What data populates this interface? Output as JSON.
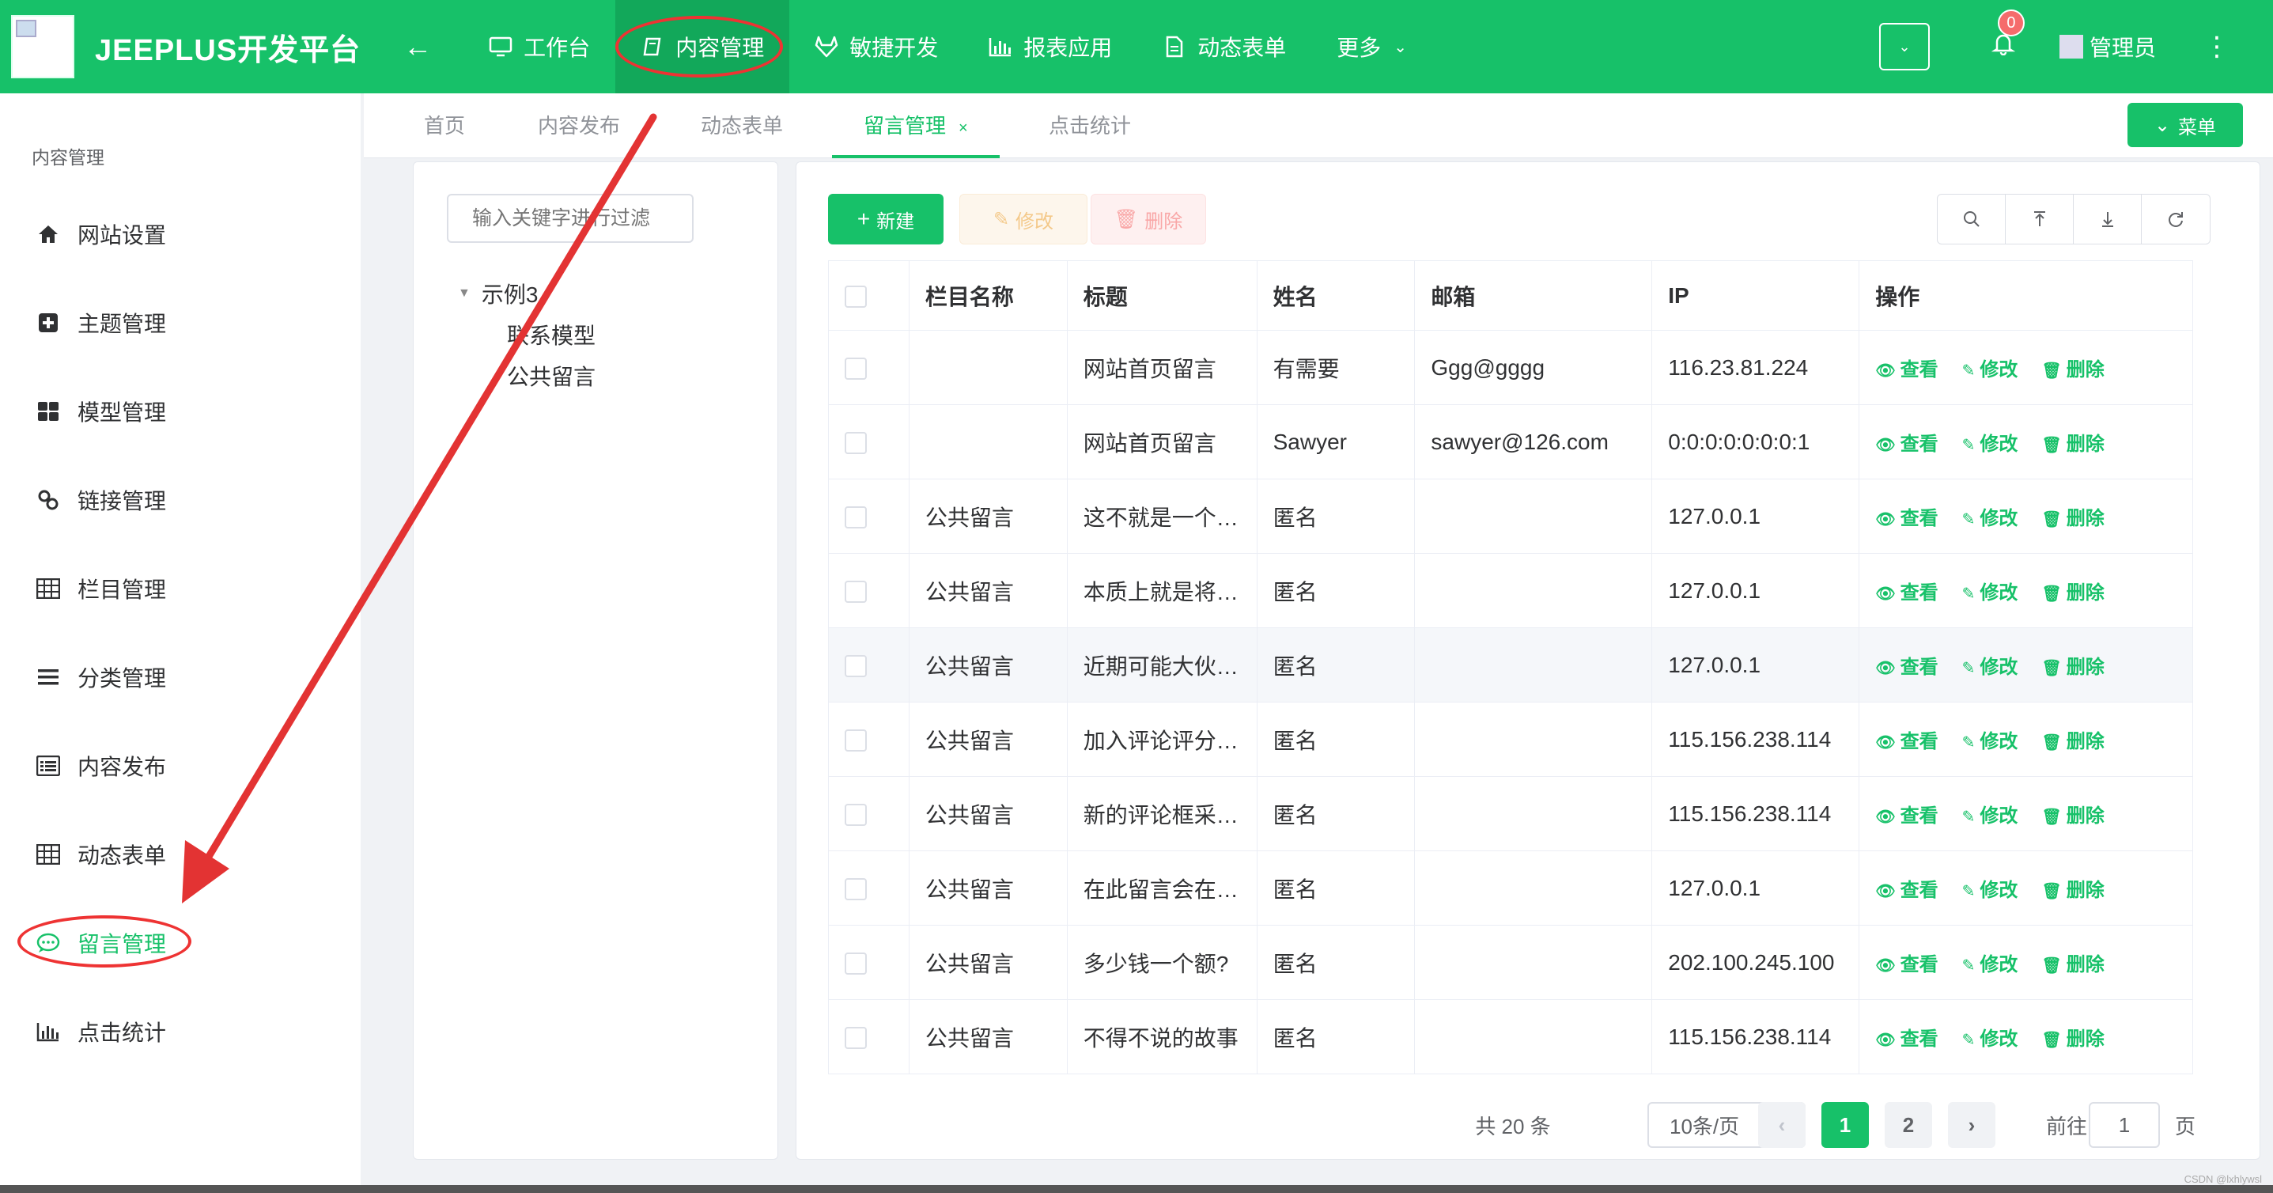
{
  "app": {
    "title": "JEEPLUS开发平台"
  },
  "topnav": [
    {
      "label": "工作台",
      "icon": "monitor-icon"
    },
    {
      "label": "内容管理",
      "icon": "book-icon",
      "active": true
    },
    {
      "label": "敏捷开发",
      "icon": "gitlab-icon"
    },
    {
      "label": "报表应用",
      "icon": "bar-chart-icon"
    },
    {
      "label": "动态表单",
      "icon": "document-icon"
    },
    {
      "label": "更多",
      "icon": "chevron-down-icon"
    }
  ],
  "topright": {
    "notifications": "0",
    "user": "管理员"
  },
  "sidebar": {
    "heading": "内容管理",
    "items": [
      {
        "label": "网站设置",
        "icon": "home-icon"
      },
      {
        "label": "主题管理",
        "icon": "plus-square-icon"
      },
      {
        "label": "模型管理",
        "icon": "grid-icon"
      },
      {
        "label": "链接管理",
        "icon": "link-icon"
      },
      {
        "label": "栏目管理",
        "icon": "table-icon"
      },
      {
        "label": "分类管理",
        "icon": "list-icon"
      },
      {
        "label": "内容发布",
        "icon": "list-alt-icon"
      },
      {
        "label": "动态表单",
        "icon": "table-icon"
      },
      {
        "label": "留言管理",
        "icon": "comment-icon",
        "active": true
      },
      {
        "label": "点击统计",
        "icon": "bar-chart-icon"
      }
    ]
  },
  "tabs": [
    {
      "label": "首页"
    },
    {
      "label": "内容发布"
    },
    {
      "label": "动态表单"
    },
    {
      "label": "留言管理",
      "active": true,
      "close": "×"
    },
    {
      "label": "点击统计"
    }
  ],
  "menu_button": "菜单",
  "tree": {
    "placeholder": "输入关键字进行过滤",
    "root": "示例3",
    "children": [
      "联系模型",
      "公共留言"
    ]
  },
  "toolbar": {
    "new": "新建",
    "edit": "修改",
    "delete": "删除"
  },
  "table": {
    "headers": [
      "栏目名称",
      "标题",
      "姓名",
      "邮箱",
      "IP",
      "操作"
    ],
    "actions": [
      "查看",
      "修改",
      "删除"
    ],
    "rows": [
      [
        "",
        "网站首页留言",
        "有需要",
        "Ggg@gggg",
        "116.23.81.224"
      ],
      [
        "",
        "网站首页留言",
        "Sawyer",
        "sawyer@126.com",
        "0:0:0:0:0:0:0:1"
      ],
      [
        "公共留言",
        "这不就是一个…",
        "匿名",
        "",
        "127.0.0.1"
      ],
      [
        "公共留言",
        "本质上就是将…",
        "匿名",
        "",
        "127.0.0.1"
      ],
      [
        "公共留言",
        "近期可能大伙…",
        "匿名",
        "",
        "127.0.0.1"
      ],
      [
        "公共留言",
        "加入评论评分…",
        "匿名",
        "",
        "115.156.238.114"
      ],
      [
        "公共留言",
        "新的评论框采…",
        "匿名",
        "",
        "115.156.238.114"
      ],
      [
        "公共留言",
        "在此留言会在…",
        "匿名",
        "",
        "127.0.0.1"
      ],
      [
        "公共留言",
        "多少钱一个额?",
        "匿名",
        "",
        "202.100.245.100"
      ],
      [
        "公共留言",
        "不得不说的故事",
        "匿名",
        "",
        "115.156.238.114"
      ]
    ]
  },
  "pager": {
    "total": "共 20 条",
    "size": "10条/页",
    "pages": [
      "1",
      "2"
    ],
    "current": "1",
    "goto_prefix": "前往",
    "goto_value": "1",
    "goto_suffix": "页"
  },
  "watermark": "CSDN @lxhlywsl",
  "colors": {
    "primary": "#17c169",
    "annotation": "#e33333"
  }
}
